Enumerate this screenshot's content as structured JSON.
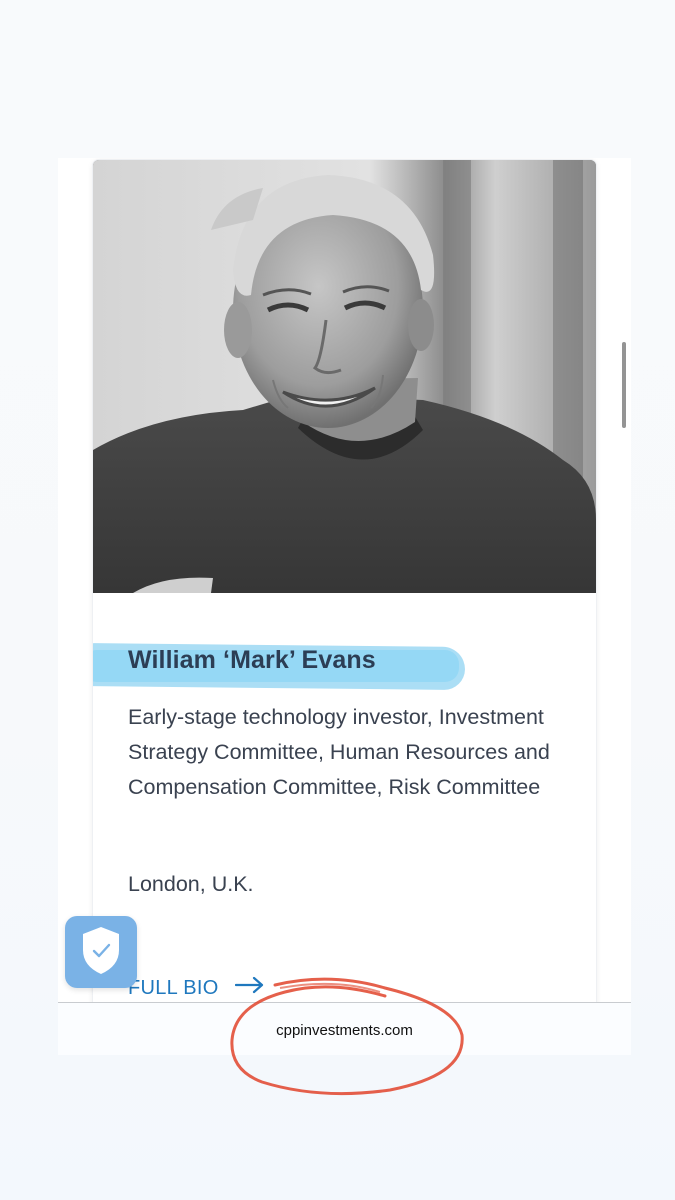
{
  "profile": {
    "name": "William ‘Mark’ Evans",
    "roles": "Early-stage technology investor, Investment Strategy Committee, Human Resources and Compensation Committee, Risk Committee",
    "location": "London, U.K.",
    "full_bio_label": "FULL BIO"
  },
  "browser": {
    "domain": "cppinvestments.com"
  },
  "icons": {
    "full_bio_arrow": "arrow-right-icon",
    "shield": "shield-check-icon"
  },
  "colors": {
    "link": "#1f78be",
    "highlight": "#58beec",
    "annotation": "#e0442c",
    "shield_button": "#7ab2e6"
  }
}
